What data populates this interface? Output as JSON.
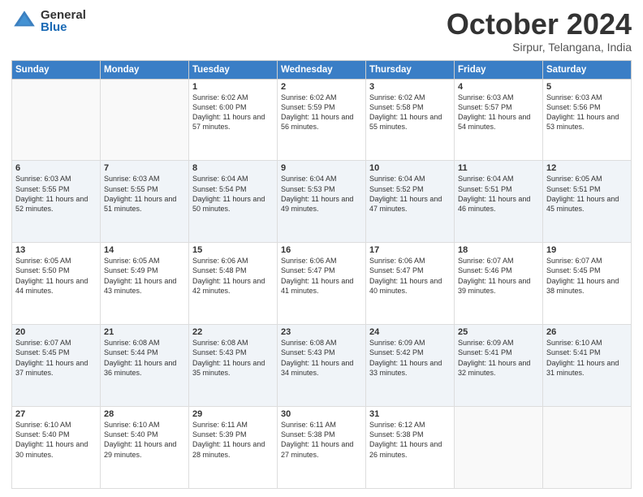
{
  "header": {
    "logo_general": "General",
    "logo_blue": "Blue",
    "month_title": "October 2024",
    "location": "Sirpur, Telangana, India"
  },
  "days_of_week": [
    "Sunday",
    "Monday",
    "Tuesday",
    "Wednesday",
    "Thursday",
    "Friday",
    "Saturday"
  ],
  "weeks": [
    [
      {
        "day": "",
        "sunrise": "",
        "sunset": "",
        "daylight": ""
      },
      {
        "day": "",
        "sunrise": "",
        "sunset": "",
        "daylight": ""
      },
      {
        "day": "1",
        "sunrise": "Sunrise: 6:02 AM",
        "sunset": "Sunset: 6:00 PM",
        "daylight": "Daylight: 11 hours and 57 minutes."
      },
      {
        "day": "2",
        "sunrise": "Sunrise: 6:02 AM",
        "sunset": "Sunset: 5:59 PM",
        "daylight": "Daylight: 11 hours and 56 minutes."
      },
      {
        "day": "3",
        "sunrise": "Sunrise: 6:02 AM",
        "sunset": "Sunset: 5:58 PM",
        "daylight": "Daylight: 11 hours and 55 minutes."
      },
      {
        "day": "4",
        "sunrise": "Sunrise: 6:03 AM",
        "sunset": "Sunset: 5:57 PM",
        "daylight": "Daylight: 11 hours and 54 minutes."
      },
      {
        "day": "5",
        "sunrise": "Sunrise: 6:03 AM",
        "sunset": "Sunset: 5:56 PM",
        "daylight": "Daylight: 11 hours and 53 minutes."
      }
    ],
    [
      {
        "day": "6",
        "sunrise": "Sunrise: 6:03 AM",
        "sunset": "Sunset: 5:55 PM",
        "daylight": "Daylight: 11 hours and 52 minutes."
      },
      {
        "day": "7",
        "sunrise": "Sunrise: 6:03 AM",
        "sunset": "Sunset: 5:55 PM",
        "daylight": "Daylight: 11 hours and 51 minutes."
      },
      {
        "day": "8",
        "sunrise": "Sunrise: 6:04 AM",
        "sunset": "Sunset: 5:54 PM",
        "daylight": "Daylight: 11 hours and 50 minutes."
      },
      {
        "day": "9",
        "sunrise": "Sunrise: 6:04 AM",
        "sunset": "Sunset: 5:53 PM",
        "daylight": "Daylight: 11 hours and 49 minutes."
      },
      {
        "day": "10",
        "sunrise": "Sunrise: 6:04 AM",
        "sunset": "Sunset: 5:52 PM",
        "daylight": "Daylight: 11 hours and 47 minutes."
      },
      {
        "day": "11",
        "sunrise": "Sunrise: 6:04 AM",
        "sunset": "Sunset: 5:51 PM",
        "daylight": "Daylight: 11 hours and 46 minutes."
      },
      {
        "day": "12",
        "sunrise": "Sunrise: 6:05 AM",
        "sunset": "Sunset: 5:51 PM",
        "daylight": "Daylight: 11 hours and 45 minutes."
      }
    ],
    [
      {
        "day": "13",
        "sunrise": "Sunrise: 6:05 AM",
        "sunset": "Sunset: 5:50 PM",
        "daylight": "Daylight: 11 hours and 44 minutes."
      },
      {
        "day": "14",
        "sunrise": "Sunrise: 6:05 AM",
        "sunset": "Sunset: 5:49 PM",
        "daylight": "Daylight: 11 hours and 43 minutes."
      },
      {
        "day": "15",
        "sunrise": "Sunrise: 6:06 AM",
        "sunset": "Sunset: 5:48 PM",
        "daylight": "Daylight: 11 hours and 42 minutes."
      },
      {
        "day": "16",
        "sunrise": "Sunrise: 6:06 AM",
        "sunset": "Sunset: 5:47 PM",
        "daylight": "Daylight: 11 hours and 41 minutes."
      },
      {
        "day": "17",
        "sunrise": "Sunrise: 6:06 AM",
        "sunset": "Sunset: 5:47 PM",
        "daylight": "Daylight: 11 hours and 40 minutes."
      },
      {
        "day": "18",
        "sunrise": "Sunrise: 6:07 AM",
        "sunset": "Sunset: 5:46 PM",
        "daylight": "Daylight: 11 hours and 39 minutes."
      },
      {
        "day": "19",
        "sunrise": "Sunrise: 6:07 AM",
        "sunset": "Sunset: 5:45 PM",
        "daylight": "Daylight: 11 hours and 38 minutes."
      }
    ],
    [
      {
        "day": "20",
        "sunrise": "Sunrise: 6:07 AM",
        "sunset": "Sunset: 5:45 PM",
        "daylight": "Daylight: 11 hours and 37 minutes."
      },
      {
        "day": "21",
        "sunrise": "Sunrise: 6:08 AM",
        "sunset": "Sunset: 5:44 PM",
        "daylight": "Daylight: 11 hours and 36 minutes."
      },
      {
        "day": "22",
        "sunrise": "Sunrise: 6:08 AM",
        "sunset": "Sunset: 5:43 PM",
        "daylight": "Daylight: 11 hours and 35 minutes."
      },
      {
        "day": "23",
        "sunrise": "Sunrise: 6:08 AM",
        "sunset": "Sunset: 5:43 PM",
        "daylight": "Daylight: 11 hours and 34 minutes."
      },
      {
        "day": "24",
        "sunrise": "Sunrise: 6:09 AM",
        "sunset": "Sunset: 5:42 PM",
        "daylight": "Daylight: 11 hours and 33 minutes."
      },
      {
        "day": "25",
        "sunrise": "Sunrise: 6:09 AM",
        "sunset": "Sunset: 5:41 PM",
        "daylight": "Daylight: 11 hours and 32 minutes."
      },
      {
        "day": "26",
        "sunrise": "Sunrise: 6:10 AM",
        "sunset": "Sunset: 5:41 PM",
        "daylight": "Daylight: 11 hours and 31 minutes."
      }
    ],
    [
      {
        "day": "27",
        "sunrise": "Sunrise: 6:10 AM",
        "sunset": "Sunset: 5:40 PM",
        "daylight": "Daylight: 11 hours and 30 minutes."
      },
      {
        "day": "28",
        "sunrise": "Sunrise: 6:10 AM",
        "sunset": "Sunset: 5:40 PM",
        "daylight": "Daylight: 11 hours and 29 minutes."
      },
      {
        "day": "29",
        "sunrise": "Sunrise: 6:11 AM",
        "sunset": "Sunset: 5:39 PM",
        "daylight": "Daylight: 11 hours and 28 minutes."
      },
      {
        "day": "30",
        "sunrise": "Sunrise: 6:11 AM",
        "sunset": "Sunset: 5:38 PM",
        "daylight": "Daylight: 11 hours and 27 minutes."
      },
      {
        "day": "31",
        "sunrise": "Sunrise: 6:12 AM",
        "sunset": "Sunset: 5:38 PM",
        "daylight": "Daylight: 11 hours and 26 minutes."
      },
      {
        "day": "",
        "sunrise": "",
        "sunset": "",
        "daylight": ""
      },
      {
        "day": "",
        "sunrise": "",
        "sunset": "",
        "daylight": ""
      }
    ]
  ]
}
